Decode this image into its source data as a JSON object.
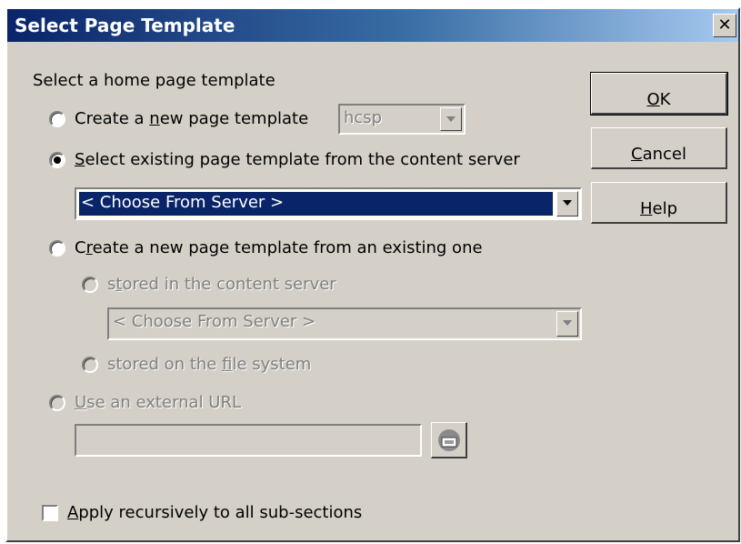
{
  "window": {
    "title": "Select Page Template",
    "close_symbol": "✕"
  },
  "prompt": "Select a home page template",
  "options": {
    "new_template": {
      "pre": "Create a ",
      "accel": "n",
      "post": "ew page template",
      "selected": false
    },
    "new_template_combo": {
      "value": "hcsp",
      "enabled": false
    },
    "existing_server": {
      "accel": "S",
      "post": "elect existing page template from the content server",
      "selected": true
    },
    "existing_server_combo": {
      "value": "< Choose From Server >",
      "enabled": true
    },
    "from_existing": {
      "pre": "C",
      "accel": "r",
      "post": "eate a new page template from an existing one",
      "selected": false
    },
    "stored_content_server": {
      "pre": "s",
      "accel": "t",
      "post": "ored in the content server",
      "enabled": false
    },
    "stored_content_server_combo": {
      "value": "< Choose From Server >",
      "enabled": false
    },
    "stored_file_system": {
      "pre": "stored on the ",
      "accel": "f",
      "post": "ile system",
      "enabled": false
    },
    "external_url": {
      "accel": "U",
      "post": "se an external URL",
      "enabled": false
    },
    "external_url_input": {
      "value": ""
    }
  },
  "apply_recursive": {
    "accel": "A",
    "post": "pply recursively to all sub-sections",
    "checked": false
  },
  "buttons": {
    "ok": {
      "accel": "O",
      "post": "K"
    },
    "cancel": {
      "accel": "C",
      "post": "ancel"
    },
    "help": {
      "accel": "H",
      "post": "elp"
    }
  },
  "colors": {
    "title_start": "#0a246a",
    "title_end": "#a6caf0",
    "face": "#d4d0c8",
    "selection": "#0a246a"
  },
  "icons": {
    "browse": "browse-folder-icon"
  }
}
